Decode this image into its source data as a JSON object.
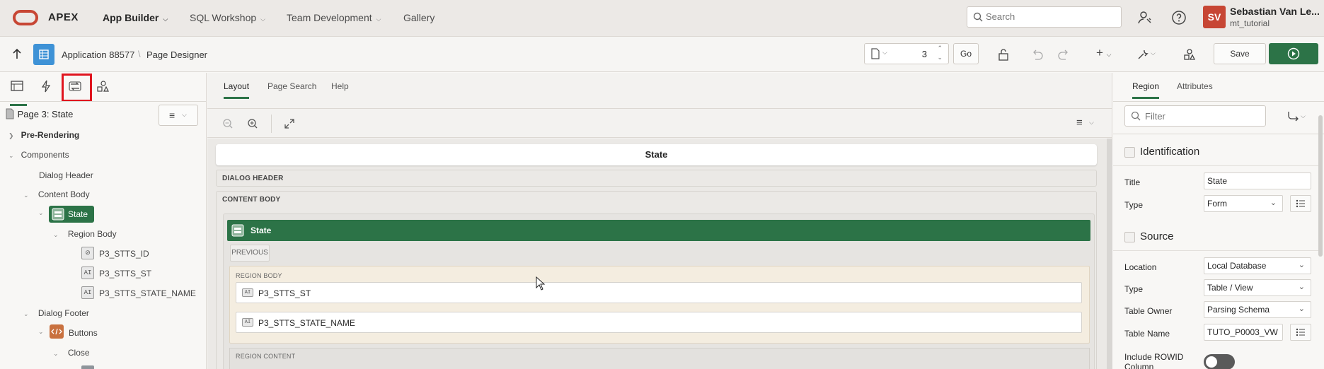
{
  "topnav": {
    "brand": "APEX",
    "items": [
      {
        "label": "App Builder",
        "active": true
      },
      {
        "label": "SQL Workshop",
        "active": false
      },
      {
        "label": "Team Development",
        "active": false
      },
      {
        "label": "Gallery",
        "active": false
      }
    ],
    "search_placeholder": "Search",
    "avatar_initials": "SV",
    "user_name": "Sebastian Van Le...",
    "workspace": "mt_tutorial"
  },
  "toolbar": {
    "breadcrumb_app": "Application 88577",
    "breadcrumb_page": "Page Designer",
    "page_number": "3",
    "go_label": "Go",
    "save_label": "Save"
  },
  "left_panel": {
    "page_label": "Page 3: State",
    "tree": {
      "pre_rendering": "Pre-Rendering",
      "components": "Components",
      "dialog_header": "Dialog Header",
      "content_body": "Content Body",
      "state": "State",
      "region_body": "Region Body",
      "item1": "P3_STTS_ID",
      "item2": "P3_STTS_ST",
      "item3": "P3_STTS_STATE_NAME",
      "dialog_footer": "Dialog Footer",
      "buttons": "Buttons",
      "close": "Close"
    }
  },
  "center": {
    "tabs": [
      "Layout",
      "Page Search",
      "Help"
    ],
    "canvas": {
      "page_title": "State",
      "dialog_header": "DIALOG HEADER",
      "content_body": "CONTENT BODY",
      "region_title": "State",
      "previous": "PREVIOUS",
      "region_body": "REGION BODY",
      "item1": "P3_STTS_ST",
      "item2": "P3_STTS_STATE_NAME",
      "region_content": "REGION CONTENT"
    }
  },
  "right_panel": {
    "tabs": [
      "Region",
      "Attributes"
    ],
    "filter_placeholder": "Filter",
    "identification": {
      "header": "Identification",
      "title_label": "Title",
      "title_value": "State",
      "type_label": "Type",
      "type_value": "Form"
    },
    "source": {
      "header": "Source",
      "location_label": "Location",
      "location_value": "Local Database",
      "type_label": "Type",
      "type_value": "Table / View",
      "owner_label": "Table Owner",
      "owner_value": "Parsing Schema",
      "name_label": "Table Name",
      "name_value": "TUTO_P0003_VW",
      "rowid_label": "Include ROWID Column"
    }
  },
  "colors": {
    "accent_green": "#2c7347",
    "brand_red": "#c74634",
    "highlight_red": "#e0141e",
    "app_blue": "#3e92d6"
  }
}
